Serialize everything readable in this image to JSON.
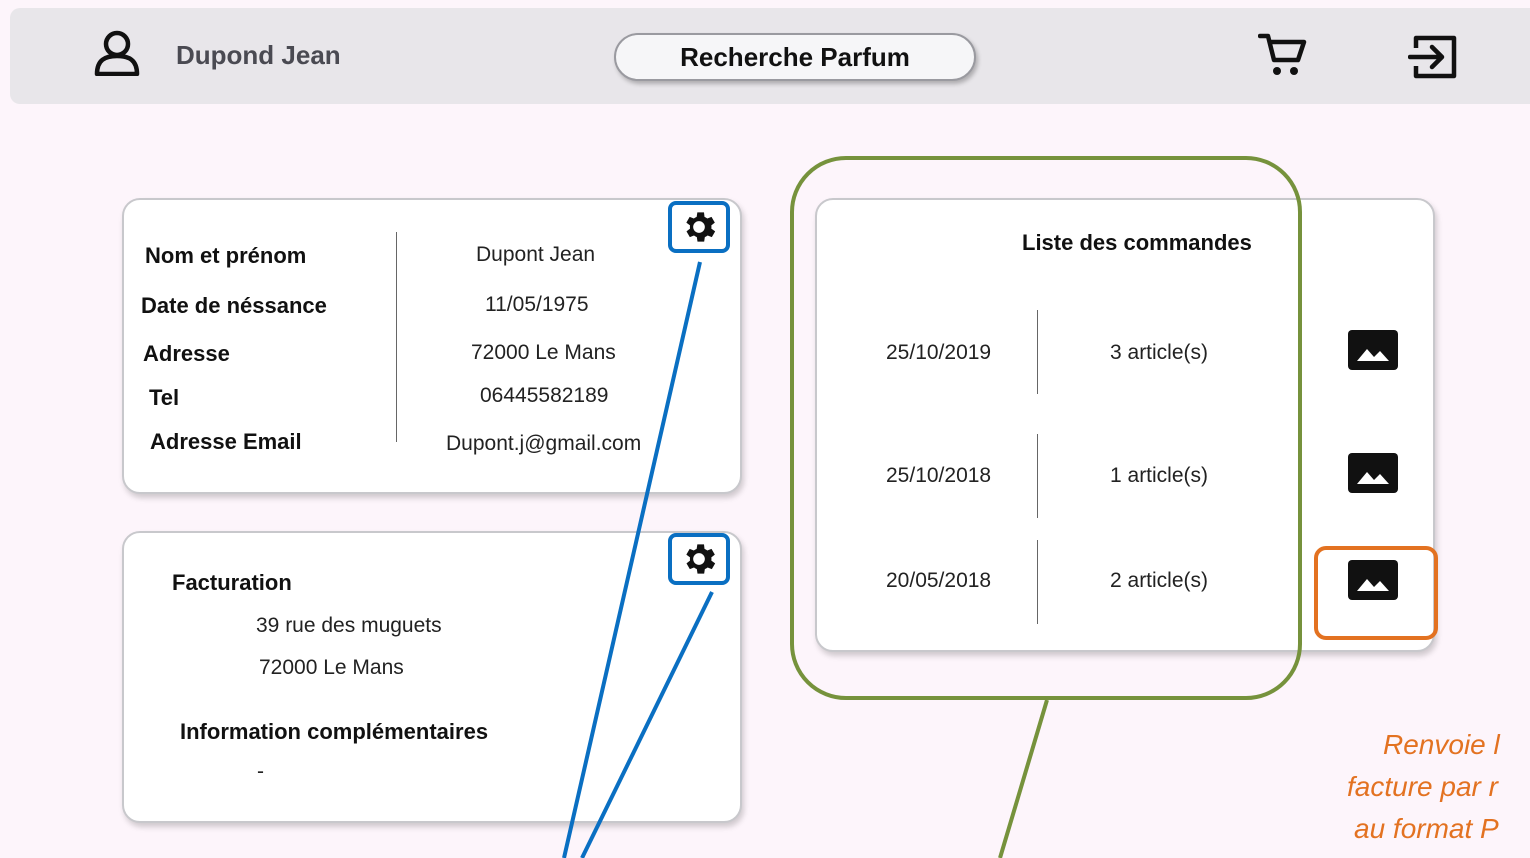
{
  "header": {
    "user_name": "Dupond Jean",
    "search_button": "Recherche Parfum",
    "icons": [
      "user-icon",
      "cart-icon",
      "logout-icon"
    ]
  },
  "profile": {
    "labels": [
      "Nom et prénom",
      "Date de néssance",
      "Adresse",
      "Tel",
      "Adresse Email"
    ],
    "values": [
      "Dupont Jean",
      "11/05/1975",
      "72000 Le Mans",
      "06445582189",
      "Dupont.j@gmail.com"
    ]
  },
  "billing": {
    "title": "Facturation",
    "address_line1": "39 rue des muguets",
    "address_line2": "72000 Le Mans",
    "extra_title": "Information complémentaires",
    "extra_value": "-"
  },
  "orders": {
    "title": "Liste des commandes",
    "rows": [
      {
        "date": "25/10/2019",
        "count": "3 article(s)"
      },
      {
        "date": "25/10/2018",
        "count": "1 article(s)"
      },
      {
        "date": "20/05/2018",
        "count": "2 article(s)"
      }
    ]
  },
  "annotation": {
    "lines": [
      "Renvoie l",
      "facture par r",
      "au format P"
    ]
  },
  "colors": {
    "highlight_blue": "#0a6fc2",
    "highlight_green": "#76923c",
    "highlight_orange": "#e37221",
    "page_bg": "#fdf5fb",
    "topbar_bg": "#e8e6ea"
  }
}
